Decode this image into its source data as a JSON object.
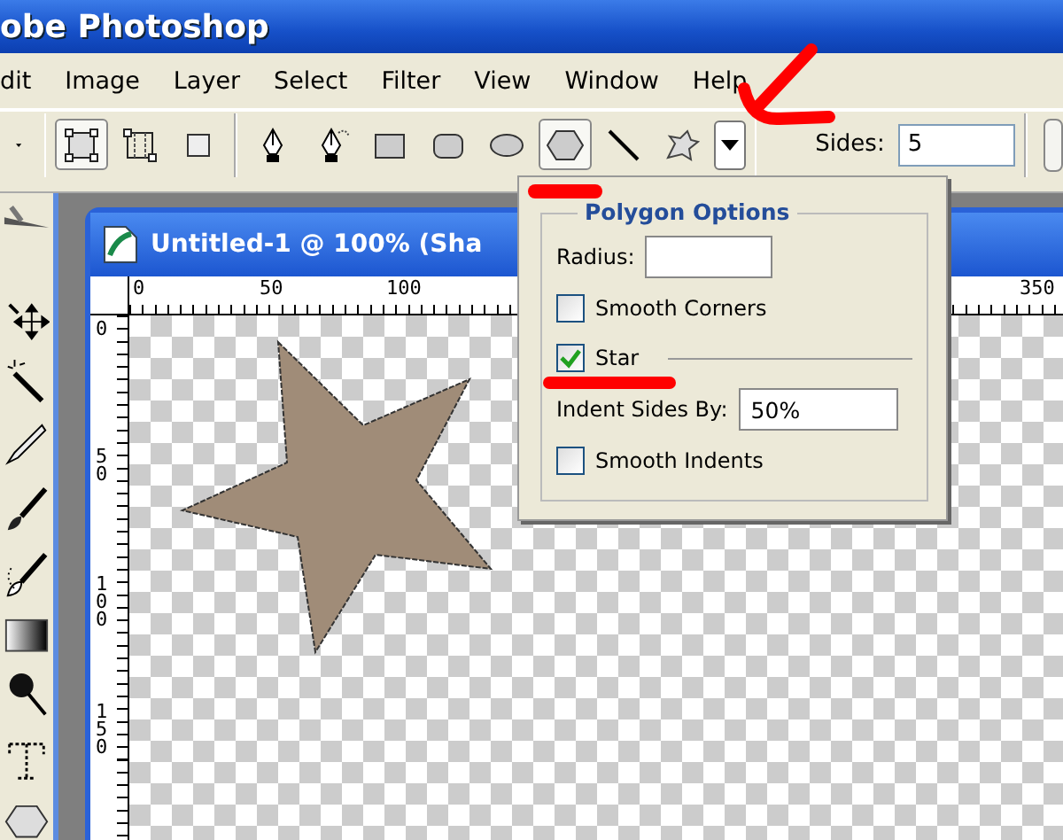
{
  "window": {
    "title": "obe Photoshop"
  },
  "menu": [
    {
      "label": "dit"
    },
    {
      "label": "Image"
    },
    {
      "label": "Layer"
    },
    {
      "label": "Select"
    },
    {
      "label": "Filter"
    },
    {
      "label": "View"
    },
    {
      "label": "Window"
    },
    {
      "label": "Help"
    }
  ],
  "options_bar": {
    "groups": [
      [
        {
          "kind": "shape-layers",
          "selected": true
        },
        {
          "kind": "paths",
          "selected": false
        },
        {
          "kind": "fill-pixels",
          "selected": false
        }
      ],
      [
        {
          "kind": "pen",
          "selected": false
        },
        {
          "kind": "freeform-pen",
          "selected": false
        },
        {
          "kind": "rectangle",
          "selected": false
        },
        {
          "kind": "rounded-rectangle",
          "selected": false
        },
        {
          "kind": "ellipse",
          "selected": false
        },
        {
          "kind": "polygon",
          "selected": true
        },
        {
          "kind": "line",
          "selected": false
        },
        {
          "kind": "custom-shape",
          "selected": false
        }
      ]
    ],
    "sides": {
      "label": "Sides:",
      "value": "5"
    }
  },
  "document": {
    "title": "Untitled-1 @ 100% (Sha",
    "top_ruler": [
      "0",
      "50",
      "100",
      "350"
    ],
    "left_ruler": [
      "0",
      "50",
      "100",
      "150"
    ]
  },
  "polygon_options": {
    "title": "Polygon Options",
    "items": [
      {
        "kind": "field",
        "label": "Radius:"
      },
      {
        "kind": "checkbox",
        "label": "Smooth Corners",
        "checked": false
      },
      {
        "kind": "checkbox",
        "label": "Star",
        "checked": true
      },
      {
        "kind": "field",
        "label": "Indent Sides By:",
        "value": "50%"
      },
      {
        "kind": "checkbox",
        "label": "Smooth Indents",
        "checked": false
      }
    ]
  }
}
